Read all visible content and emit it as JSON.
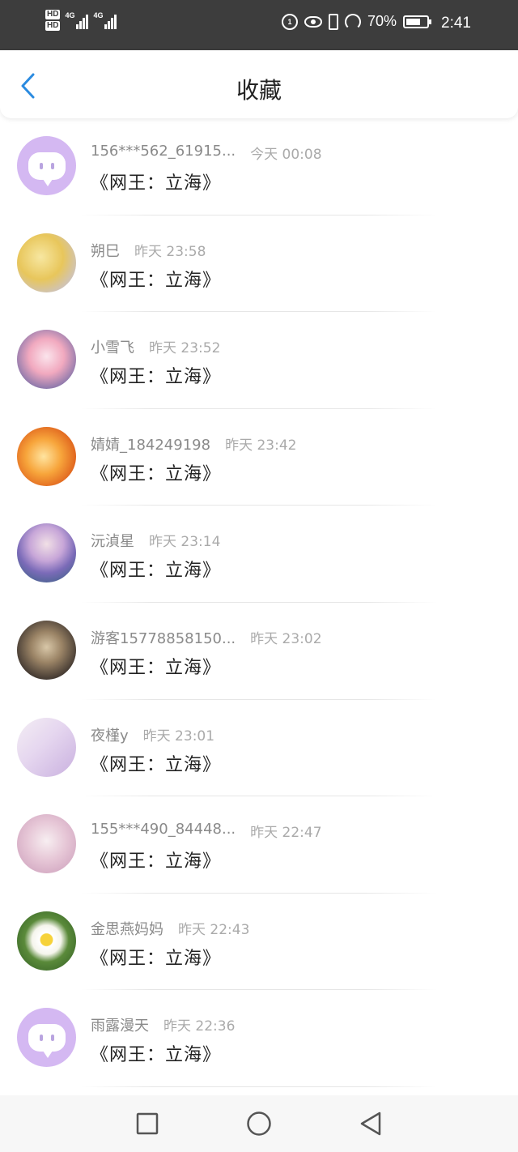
{
  "status_bar": {
    "left_labels": [
      "HD",
      "HD"
    ],
    "network": [
      "4G",
      "4G"
    ],
    "battery_percent": "70%",
    "battery_level": 0.7,
    "time": "2:41",
    "icons": [
      "data-saver-icon",
      "eye-comfort-icon",
      "vibrate-icon",
      "speed-icon",
      "battery-icon"
    ]
  },
  "header": {
    "title": "收藏",
    "back_icon": "chevron-left-icon",
    "accent_color": "#2b8be0"
  },
  "list": {
    "items": [
      {
        "user": "156***562_61915...",
        "time": "今天 00:08",
        "book": "《网王：立海》",
        "avatar": "default-bubble"
      },
      {
        "user": "朔巳",
        "time": "昨天 23:58",
        "book": "《网王：立海》",
        "avatar": "anime-blonde"
      },
      {
        "user": "小雪飞",
        "time": "昨天 23:52",
        "book": "《网王：立海》",
        "avatar": "anime-pink"
      },
      {
        "user": "婧婧_184249198",
        "time": "昨天 23:42",
        "book": "《网王：立海》",
        "avatar": "anime-orange"
      },
      {
        "user": "沅湞星",
        "time": "昨天 23:14",
        "book": "《网王：立海》",
        "avatar": "anime-purple-hair"
      },
      {
        "user": "游客15778858150...",
        "time": "昨天 23:02",
        "book": "《网王：立海》",
        "avatar": "kitten-photo"
      },
      {
        "user": "夜槿y",
        "time": "昨天 23:01",
        "book": "《网王：立海》",
        "avatar": "lavender-text"
      },
      {
        "user": "155***490_84448...",
        "time": "昨天 22:47",
        "book": "《网王：立海》",
        "avatar": "anime-sketch"
      },
      {
        "user": "金思燕妈妈",
        "time": "昨天 22:43",
        "book": "《网王：立海》",
        "avatar": "daisy-photo"
      },
      {
        "user": "雨露漫天",
        "time": "昨天 22:36",
        "book": "《网王：立海》",
        "avatar": "default-bubble"
      }
    ]
  },
  "nav_bar": {
    "buttons": [
      "recents-square-icon",
      "home-circle-icon",
      "back-triangle-icon"
    ]
  }
}
